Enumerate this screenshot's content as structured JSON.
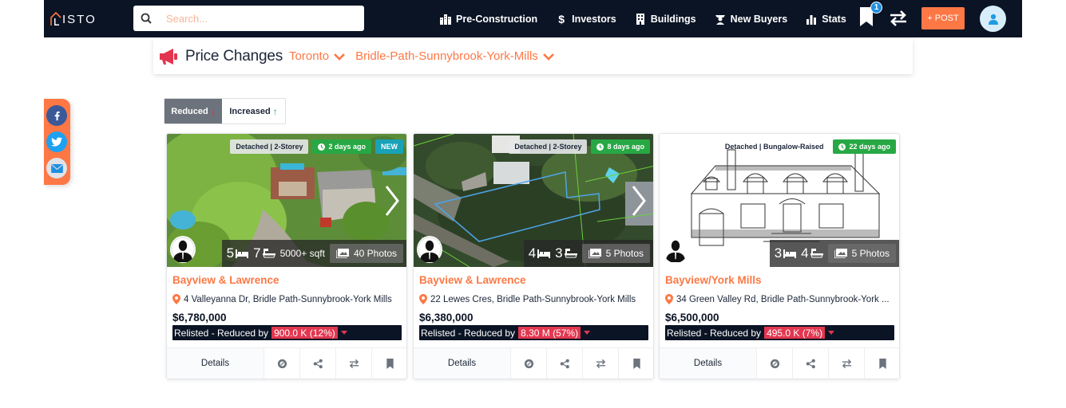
{
  "navbar": {
    "logo_text": "ISTO",
    "search_placeholder": "Search...",
    "links": [
      {
        "label": "Pre-Construction",
        "icon": "city-icon"
      },
      {
        "label": "Investors",
        "icon": "dollar-icon"
      },
      {
        "label": "Buildings",
        "icon": "building-icon"
      },
      {
        "label": "New Buyers",
        "icon": "graduate-icon"
      },
      {
        "label": "Stats",
        "icon": "bar-chart-icon"
      }
    ],
    "saved_badge_count": "1",
    "post_label": "+ POST"
  },
  "header": {
    "title": "Price Changes",
    "city_dropdown": "Toronto",
    "area_dropdown": "Bridle-Path-Sunnybrook-York-Mills"
  },
  "social": [
    "facebook",
    "twitter",
    "email"
  ],
  "filter": {
    "reduced_label": "Reduced",
    "increased_label": "Increased",
    "active": "Reduced"
  },
  "colors": {
    "accent": "#fd7845",
    "navy": "#0b1425",
    "green": "#27a844",
    "teal": "#18a2b8",
    "red": "#e2364f"
  },
  "listings": [
    {
      "type": "Detached | 2-Storey",
      "time": "2 days ago",
      "new_label": "NEW",
      "beds": "5",
      "baths": "7",
      "sqft": "5000+ sqft",
      "photos": "40 Photos",
      "title": "Bayview & Lawrence",
      "address": "4 Valleyanna Dr, Bridle Path-Sunnybrook-York Mills",
      "price": "$6,780,000",
      "status_prefix": "Relisted - Reduced by",
      "reduction": "900.0 K (12%)",
      "details_label": "Details"
    },
    {
      "type": "Detached | 2-Storey",
      "time": "8 days ago",
      "beds": "4",
      "baths": "3",
      "photos": "5 Photos",
      "title": "Bayview & Lawrence",
      "address": "22 Lewes Cres, Bridle Path-Sunnybrook-York Mills",
      "price": "$6,380,000",
      "status_prefix": "Relisted - Reduced by",
      "reduction": "8.30 M (57%)",
      "details_label": "Details"
    },
    {
      "type": "Detached | Bungalow-Raised",
      "time": "22 days ago",
      "beds": "3",
      "baths": "4",
      "photos": "5 Photos",
      "title": "Bayview/York Mills",
      "address": "34 Green Valley Rd, Bridle Path-Sunnybrook-York ...",
      "price": "$6,500,000",
      "status_prefix": "Relisted - Reduced by",
      "reduction": "495.0 K (7%)",
      "details_label": "Details"
    }
  ]
}
